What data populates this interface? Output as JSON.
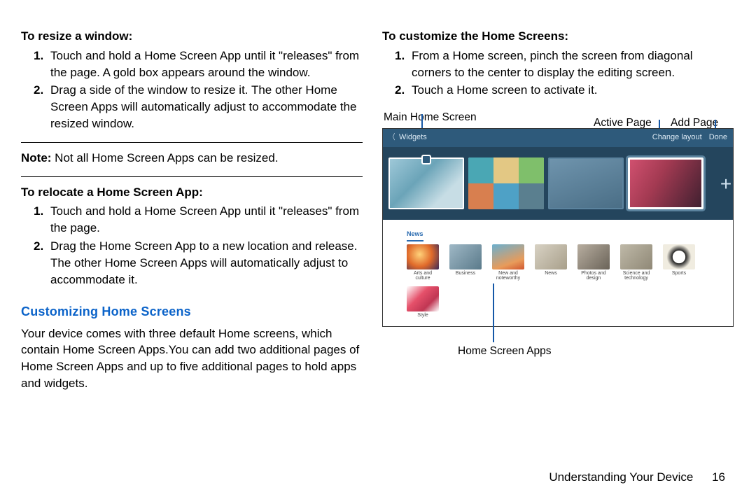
{
  "left": {
    "resize": {
      "heading": "To resize a window:",
      "steps": [
        "Touch and hold a Home Screen App until it \"releases\" from the page. A gold box appears around the window.",
        "Drag a side of the window to resize it. The other Home Screen Apps will automatically adjust to accommodate the resized window."
      ]
    },
    "note_label": "Note:",
    "note_text": " Not all Home Screen Apps can be resized.",
    "relocate": {
      "heading": "To relocate a Home Screen App:",
      "steps": [
        "Touch and hold a Home Screen App until it \"releases\" from the page.",
        "Drag the Home Screen App to a new location and release. The other Home Screen Apps will automatically adjust to accommodate it."
      ]
    },
    "custom_title": "Customizing Home Screens",
    "custom_body": "Your device comes with three default Home screens, which contain Home Screen Apps.You can add two additional pages of Home Screen Apps and up to five additional pages to hold apps and widgets."
  },
  "right": {
    "customize": {
      "heading": "To customize the Home Screens:",
      "steps": [
        "From a Home screen, pinch the screen from diagonal corners to the center to display the editing screen.",
        "Touch a Home screen to activate it."
      ]
    },
    "labels": {
      "main": "Main Home Screen",
      "active": "Active Page",
      "add": "Add Page",
      "apps": "Home Screen Apps"
    },
    "fig": {
      "topbar_back": "Widgets",
      "topbar_change": "Change layout",
      "topbar_done": "Done",
      "news_tab": "News",
      "plus": "+",
      "categories": [
        "Arts and culture",
        "Business",
        "New and noteworthy",
        "News",
        "Photos and design",
        "Science and technology",
        "Sports"
      ],
      "style_cat": "Style"
    }
  },
  "footer": {
    "chapter": "Understanding Your Device",
    "page": "16"
  }
}
